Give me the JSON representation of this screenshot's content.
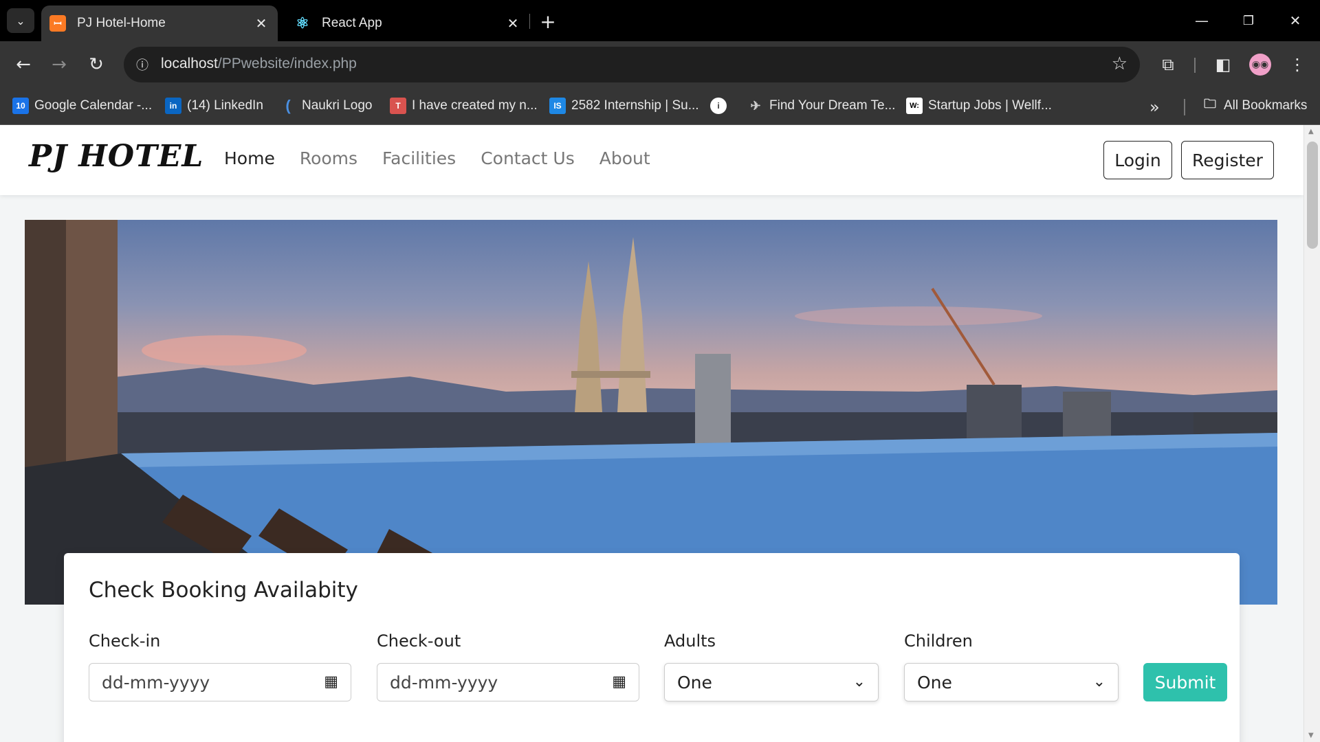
{
  "browser": {
    "tabs": [
      {
        "title": "PJ Hotel-Home",
        "icon": "xampp-icon",
        "active": true
      },
      {
        "title": "React App",
        "icon": "react-icon",
        "active": false
      }
    ],
    "url_host": "localhost",
    "url_path": "/PPwebsite/index.php",
    "bookmarks": [
      {
        "label": "Google Calendar -...",
        "icon": "calendar-icon",
        "badge": "10",
        "color": "#1a73e8"
      },
      {
        "label": "(14) LinkedIn",
        "icon": "linkedin-icon",
        "badge": "in",
        "color": "#0a66c2"
      },
      {
        "label": "Naukri Logo",
        "icon": "naukri-icon",
        "badge": "(",
        "color": "#4a90e2"
      },
      {
        "label": "I have created my n...",
        "icon": "bookmark-icon",
        "badge": "T",
        "color": "#d9534f"
      },
      {
        "label": "2582 Internship | Su...",
        "icon": "internshala-icon",
        "badge": "IS",
        "color": "#1e88e5"
      },
      {
        "label": "",
        "icon": "info-icon",
        "badge": "i",
        "color": "#ffffff"
      },
      {
        "label": "Find Your Dream Te...",
        "icon": "rocket-icon",
        "badge": "✈",
        "color": "#9e9e9e"
      },
      {
        "label": "Startup Jobs | Wellf...",
        "icon": "wellfound-icon",
        "badge": "W:",
        "color": "#ffffff"
      }
    ],
    "all_bookmarks": "All Bookmarks"
  },
  "site": {
    "brand": "PJ HOTEL",
    "nav": [
      "Home",
      "Rooms",
      "Facilities",
      "Contact Us",
      "About"
    ],
    "login": "Login",
    "register": "Register"
  },
  "booking": {
    "title": "Check Booking Availabity",
    "checkin_label": "Check-in",
    "checkout_label": "Check-out",
    "adults_label": "Adults",
    "children_label": "Children",
    "date_placeholder": "dd-mm-yyyy",
    "adults_value": "One",
    "children_value": "One",
    "submit": "Submit",
    "accent_color": "#2ec1ac"
  }
}
